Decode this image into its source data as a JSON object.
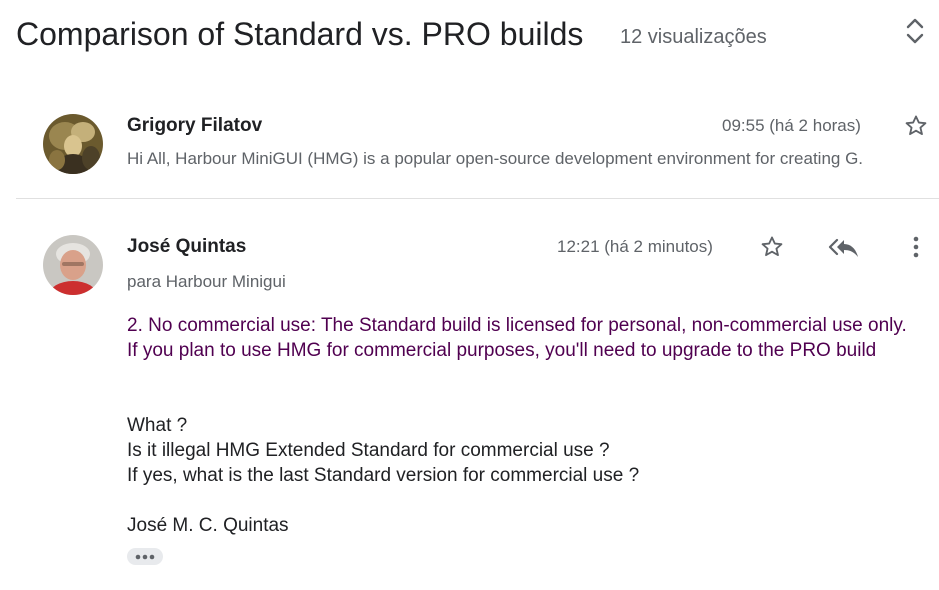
{
  "thread": {
    "title": "Comparison of Standard vs. PRO builds",
    "view_count": "12 visualizações"
  },
  "icons": {
    "expand": "unfold-more-icon",
    "star": "star-outline-icon",
    "reply_all": "reply-all-icon",
    "more": "more-vert-icon",
    "ellipsis": "more-horiz-icon"
  },
  "colors": {
    "quoted_text": "#500050",
    "secondary_text": "#5f6368",
    "primary_text": "#202124"
  },
  "messages": [
    {
      "sender": "Grigory Filatov",
      "time": "09:55 (há 2 horas)",
      "snippet": "Hi All, Harbour MiniGUI (HMG) is a popular open-source development environment for creating G."
    },
    {
      "sender": "José Quintas",
      "time": "12:21 (há 2 minutos)",
      "recipients": "para Harbour Minigui",
      "quoted": "2. No commercial use: The Standard build is licensed for personal, non-commercial use only. If you plan to use HMG for commercial purposes, you'll need to upgrade to the PRO build",
      "lines": [
        "What ?",
        "Is it illegal HMG Extended Standard for commercial use ?",
        "If yes, what is the last Standard version for commercial use ?"
      ],
      "signature": "José M. C. Quintas"
    }
  ]
}
